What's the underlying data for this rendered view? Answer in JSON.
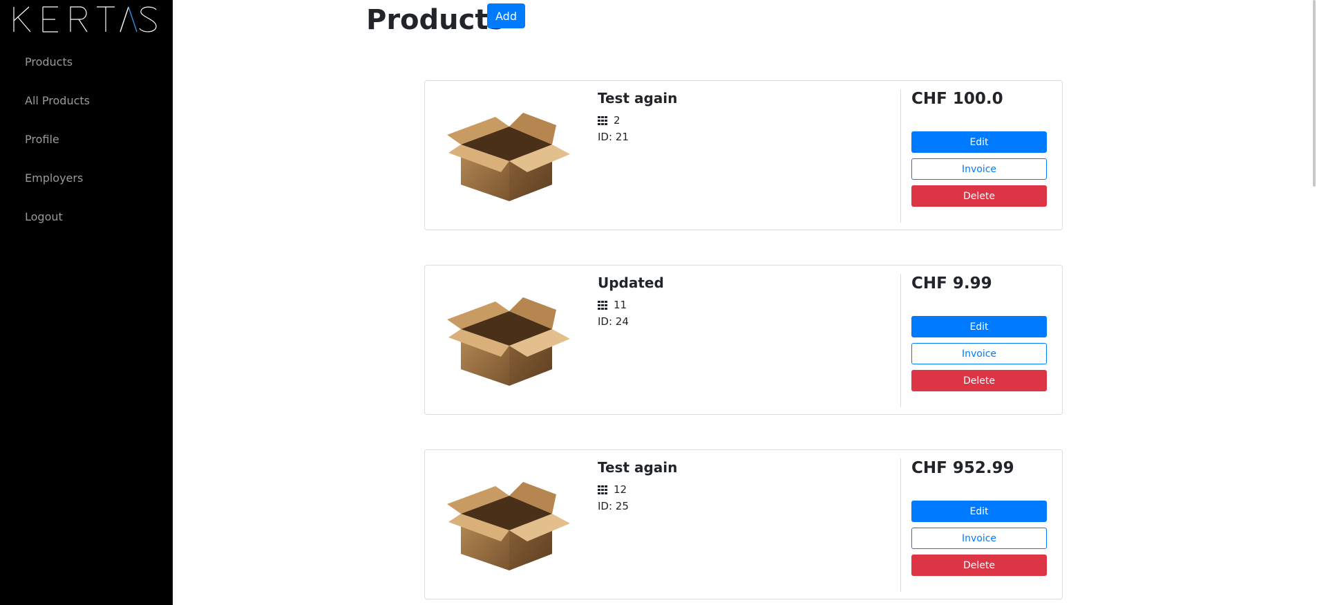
{
  "app": {
    "logo_text": "KERTAS"
  },
  "sidebar": {
    "items": [
      {
        "label": "Products"
      },
      {
        "label": "All Products"
      },
      {
        "label": "Profile"
      },
      {
        "label": "Employers"
      },
      {
        "label": "Logout"
      }
    ]
  },
  "header": {
    "title": "Products",
    "add_label": "Add"
  },
  "products": [
    {
      "name": "Test again",
      "quantity": "2",
      "id_text": "ID: 21",
      "price": "CHF 100.0",
      "edit_label": "Edit",
      "invoice_label": "Invoice",
      "delete_label": "Delete"
    },
    {
      "name": "Updated",
      "quantity": "11",
      "id_text": "ID: 24",
      "price": "CHF 9.99",
      "edit_label": "Edit",
      "invoice_label": "Invoice",
      "delete_label": "Delete"
    },
    {
      "name": "Test again",
      "quantity": "12",
      "id_text": "ID: 25",
      "price": "CHF 952.99",
      "edit_label": "Edit",
      "invoice_label": "Invoice",
      "delete_label": "Delete"
    }
  ],
  "colors": {
    "primary": "#007bff",
    "danger": "#dc3545",
    "sidebar_bg": "#000000",
    "logo_accent": "#2a8fe0"
  },
  "icons": {
    "quantity": "grid-icon",
    "product_image": "open-box-icon"
  }
}
